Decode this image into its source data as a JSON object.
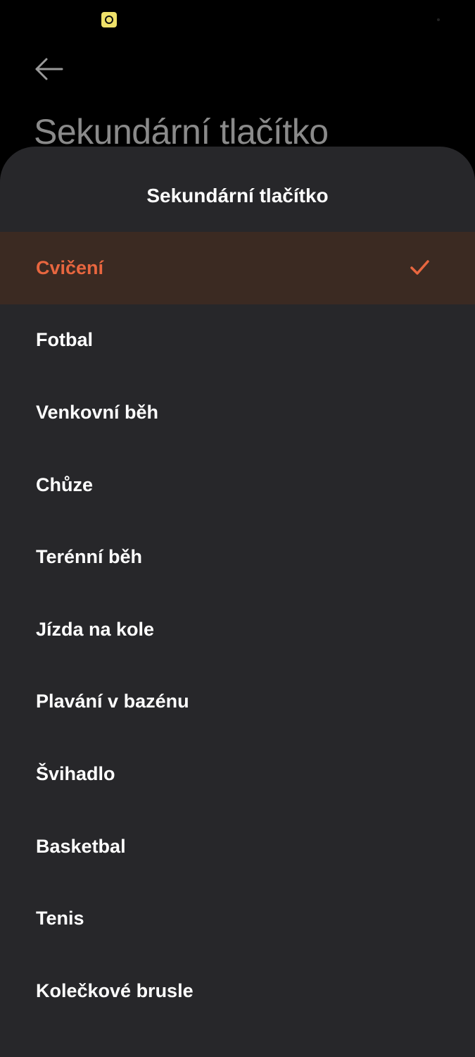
{
  "colors": {
    "background": "#000000",
    "sheet": "#27272a",
    "accent": "#e8663f",
    "selected_row": "#3b2a22",
    "text": "#ffffff",
    "title_dim": "#8a8a8a"
  },
  "status_bar": {
    "icons": [
      "screen-record-icon"
    ]
  },
  "header": {
    "back_icon": "arrow-left-icon",
    "title": "Sekundární tlačítko"
  },
  "sheet": {
    "title": "Sekundární tlačítko",
    "selected_icon": "checkmark-icon",
    "options": [
      {
        "label": "Cvičení",
        "selected": true
      },
      {
        "label": "Fotbal",
        "selected": false
      },
      {
        "label": "Venkovní běh",
        "selected": false
      },
      {
        "label": "Chůze",
        "selected": false
      },
      {
        "label": "Terénní běh",
        "selected": false
      },
      {
        "label": "Jízda na kole",
        "selected": false
      },
      {
        "label": "Plavání v bazénu",
        "selected": false
      },
      {
        "label": "Švihadlo",
        "selected": false
      },
      {
        "label": "Basketbal",
        "selected": false
      },
      {
        "label": "Tenis",
        "selected": false
      },
      {
        "label": "Kolečkové brusle",
        "selected": false
      }
    ]
  }
}
